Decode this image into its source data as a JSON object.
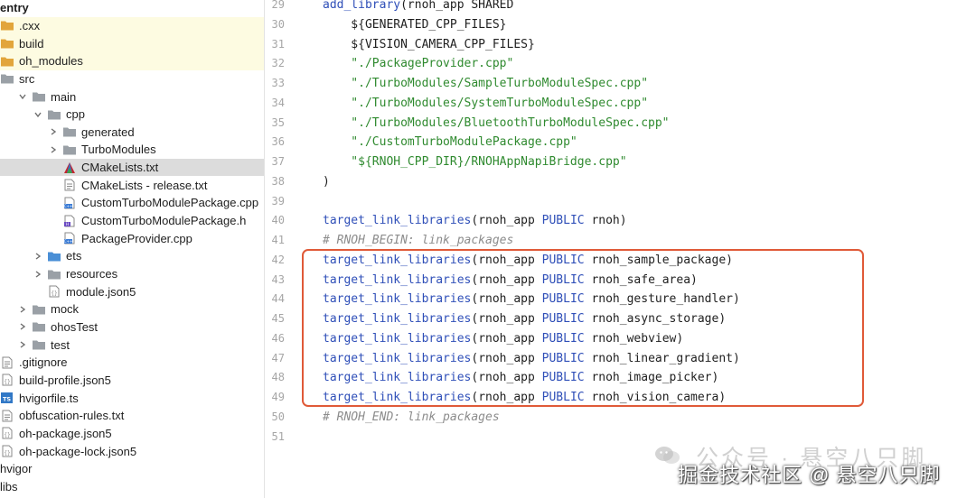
{
  "project_tree": {
    "items": [
      {
        "label": "entry",
        "depth": 0,
        "chevron": "none",
        "icon": "none",
        "bold": true,
        "highlight": "none"
      },
      {
        "label": ".cxx",
        "depth": 0,
        "chevron": "none",
        "icon": "folder-orange",
        "highlight": "yellow"
      },
      {
        "label": "build",
        "depth": 0,
        "chevron": "none",
        "icon": "folder-orange",
        "highlight": "yellow"
      },
      {
        "label": "oh_modules",
        "depth": 0,
        "chevron": "none",
        "icon": "folder-orange",
        "highlight": "yellow"
      },
      {
        "label": "src",
        "depth": 0,
        "chevron": "none",
        "icon": "folder-gray",
        "highlight": "none"
      },
      {
        "label": "main",
        "depth": 1,
        "chevron": "down",
        "icon": "folder-gray",
        "highlight": "none"
      },
      {
        "label": "cpp",
        "depth": 2,
        "chevron": "down",
        "icon": "folder-gray",
        "highlight": "none"
      },
      {
        "label": "generated",
        "depth": 3,
        "chevron": "right",
        "icon": "folder-gray",
        "highlight": "none"
      },
      {
        "label": "TurboModules",
        "depth": 3,
        "chevron": "right",
        "icon": "folder-gray",
        "highlight": "none"
      },
      {
        "label": "CMakeLists.txt",
        "depth": 3,
        "chevron": "none",
        "icon": "cmake-file",
        "highlight": "selected"
      },
      {
        "label": "CMakeLists - release.txt",
        "depth": 3,
        "chevron": "none",
        "icon": "text-file",
        "highlight": "none"
      },
      {
        "label": "CustomTurboModulePackage.cpp",
        "depth": 3,
        "chevron": "none",
        "icon": "cpp-file",
        "highlight": "none"
      },
      {
        "label": "CustomTurboModulePackage.h",
        "depth": 3,
        "chevron": "none",
        "icon": "h-file",
        "highlight": "none"
      },
      {
        "label": "PackageProvider.cpp",
        "depth": 3,
        "chevron": "none",
        "icon": "cpp-file",
        "highlight": "none"
      },
      {
        "label": "ets",
        "depth": 2,
        "chevron": "right",
        "icon": "folder-blue",
        "highlight": "none"
      },
      {
        "label": "resources",
        "depth": 2,
        "chevron": "right",
        "icon": "folder-gray",
        "highlight": "none"
      },
      {
        "label": "module.json5",
        "depth": 2,
        "chevron": "none",
        "icon": "json-file",
        "highlight": "none"
      },
      {
        "label": "mock",
        "depth": 1,
        "chevron": "right",
        "icon": "folder-gray",
        "highlight": "none"
      },
      {
        "label": "ohosTest",
        "depth": 1,
        "chevron": "right",
        "icon": "folder-gray",
        "highlight": "none"
      },
      {
        "label": "test",
        "depth": 1,
        "chevron": "right",
        "icon": "folder-gray",
        "highlight": "none"
      },
      {
        "label": ".gitignore",
        "depth": 0,
        "chevron": "none",
        "icon": "text-file",
        "highlight": "none"
      },
      {
        "label": "build-profile.json5",
        "depth": 0,
        "chevron": "none",
        "icon": "json-file",
        "highlight": "none"
      },
      {
        "label": "hvigorfile.ts",
        "depth": 0,
        "chevron": "none",
        "icon": "ts-file",
        "highlight": "none"
      },
      {
        "label": "obfuscation-rules.txt",
        "depth": 0,
        "chevron": "none",
        "icon": "text-file",
        "highlight": "none"
      },
      {
        "label": "oh-package.json5",
        "depth": 0,
        "chevron": "none",
        "icon": "json-file",
        "highlight": "none"
      },
      {
        "label": "oh-package-lock.json5",
        "depth": 0,
        "chevron": "none",
        "icon": "json-file",
        "highlight": "none"
      },
      {
        "label": "hvigor",
        "depth": 0,
        "chevron": "none",
        "icon": "none",
        "highlight": "none"
      },
      {
        "label": "libs",
        "depth": 0,
        "chevron": "none",
        "icon": "none",
        "highlight": "none"
      }
    ]
  },
  "editor": {
    "lines": [
      {
        "num": "29",
        "tokens": [
          {
            "t": "fn",
            "v": "add_library"
          },
          {
            "t": "txt",
            "v": "(rnoh_app SHARED"
          }
        ]
      },
      {
        "num": "30",
        "tokens": [
          {
            "t": "txt",
            "v": "    ${GENERATED_CPP_FILES}"
          }
        ]
      },
      {
        "num": "31",
        "tokens": [
          {
            "t": "txt",
            "v": "    ${VISION_CAMERA_CPP_FILES}"
          }
        ]
      },
      {
        "num": "32",
        "tokens": [
          {
            "t": "str",
            "v": "    \"./PackageProvider.cpp\""
          }
        ]
      },
      {
        "num": "33",
        "tokens": [
          {
            "t": "str",
            "v": "    \"./TurboModules/SampleTurboModuleSpec.cpp\""
          }
        ]
      },
      {
        "num": "34",
        "tokens": [
          {
            "t": "str",
            "v": "    \"./TurboModules/SystemTurboModuleSpec.cpp\""
          }
        ]
      },
      {
        "num": "35",
        "tokens": [
          {
            "t": "str",
            "v": "    \"./TurboModules/BluetoothTurboModuleSpec.cpp\""
          }
        ]
      },
      {
        "num": "36",
        "tokens": [
          {
            "t": "str",
            "v": "    \"./CustomTurboModulePackage.cpp\""
          }
        ]
      },
      {
        "num": "37",
        "tokens": [
          {
            "t": "str",
            "v": "    \"${RNOH_CPP_DIR}/RNOHAppNapiBridge.cpp\""
          }
        ]
      },
      {
        "num": "38",
        "tokens": [
          {
            "t": "txt",
            "v": ")"
          }
        ]
      },
      {
        "num": "39",
        "tokens": []
      },
      {
        "num": "40",
        "tokens": [
          {
            "t": "fn",
            "v": "target_link_libraries"
          },
          {
            "t": "txt",
            "v": "(rnoh_app "
          },
          {
            "t": "kw",
            "v": "PUBLIC"
          },
          {
            "t": "txt",
            "v": " rnoh)"
          }
        ]
      },
      {
        "num": "41",
        "tokens": [
          {
            "t": "cmt",
            "v": "# RNOH_BEGIN: link_packages"
          }
        ]
      },
      {
        "num": "42",
        "tokens": [
          {
            "t": "fn",
            "v": "target_link_libraries"
          },
          {
            "t": "txt",
            "v": "(rnoh_app "
          },
          {
            "t": "kw",
            "v": "PUBLIC"
          },
          {
            "t": "txt",
            "v": " rnoh_sample_package)"
          }
        ]
      },
      {
        "num": "43",
        "tokens": [
          {
            "t": "fn",
            "v": "target_link_libraries"
          },
          {
            "t": "txt",
            "v": "(rnoh_app "
          },
          {
            "t": "kw",
            "v": "PUBLIC"
          },
          {
            "t": "txt",
            "v": " rnoh_safe_area)"
          }
        ]
      },
      {
        "num": "44",
        "tokens": [
          {
            "t": "fn",
            "v": "target_link_libraries"
          },
          {
            "t": "txt",
            "v": "(rnoh_app "
          },
          {
            "t": "kw",
            "v": "PUBLIC"
          },
          {
            "t": "txt",
            "v": " rnoh_gesture_handler)"
          }
        ]
      },
      {
        "num": "45",
        "tokens": [
          {
            "t": "fn",
            "v": "target_link_libraries"
          },
          {
            "t": "txt",
            "v": "(rnoh_app "
          },
          {
            "t": "kw",
            "v": "PUBLIC"
          },
          {
            "t": "txt",
            "v": " rnoh_async_storage)"
          }
        ]
      },
      {
        "num": "46",
        "tokens": [
          {
            "t": "fn",
            "v": "target_link_libraries"
          },
          {
            "t": "txt",
            "v": "(rnoh_app "
          },
          {
            "t": "kw",
            "v": "PUBLIC"
          },
          {
            "t": "txt",
            "v": " rnoh_webview)"
          }
        ]
      },
      {
        "num": "47",
        "tokens": [
          {
            "t": "fn",
            "v": "target_link_libraries"
          },
          {
            "t": "txt",
            "v": "(rnoh_app "
          },
          {
            "t": "kw",
            "v": "PUBLIC"
          },
          {
            "t": "txt",
            "v": " rnoh_linear_gradient)"
          }
        ]
      },
      {
        "num": "48",
        "tokens": [
          {
            "t": "fn",
            "v": "target_link_libraries"
          },
          {
            "t": "txt",
            "v": "(rnoh_app "
          },
          {
            "t": "kw",
            "v": "PUBLIC"
          },
          {
            "t": "txt",
            "v": " rnoh_image_picker)"
          }
        ]
      },
      {
        "num": "49",
        "tokens": [
          {
            "t": "fn",
            "v": "target_link_libraries"
          },
          {
            "t": "txt",
            "v": "(rnoh_app "
          },
          {
            "t": "kw",
            "v": "PUBLIC"
          },
          {
            "t": "txt",
            "v": " rnoh_vision_camera)"
          }
        ]
      },
      {
        "num": "50",
        "tokens": [
          {
            "t": "cmt",
            "v": "# RNOH_END: link_packages"
          }
        ]
      },
      {
        "num": "51",
        "tokens": []
      }
    ],
    "highlight_color": "#e05a38"
  },
  "watermark": {
    "top": "公众号 · 悬空八只脚",
    "bottom": "掘金技术社区 @ 悬空八只脚"
  },
  "colors": {
    "folder_orange": "#e2a53b",
    "folder_gray": "#9aa0a6",
    "folder_blue": "#4a8fd6",
    "selected_row": "#dcdcdc",
    "excluded_row": "#fdfbe1"
  }
}
